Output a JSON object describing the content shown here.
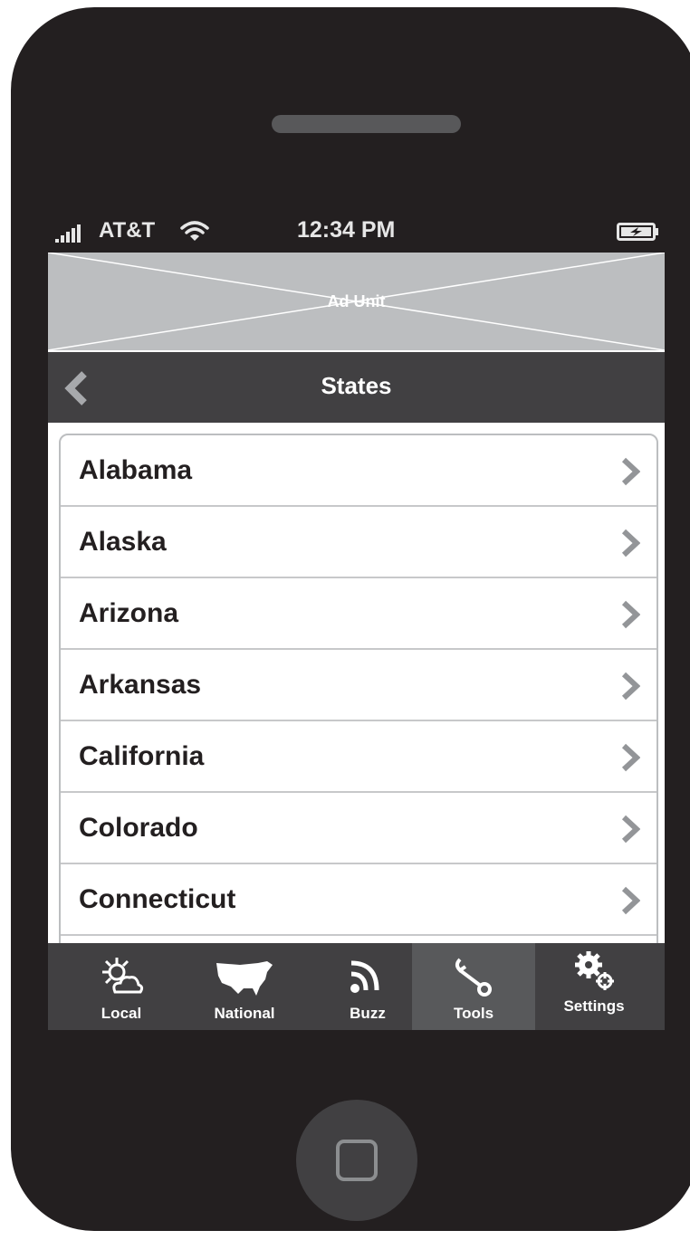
{
  "status_bar": {
    "carrier": "AT&T",
    "time": "12:34 PM"
  },
  "ad": {
    "label": "Ad Unit"
  },
  "nav": {
    "title": "States"
  },
  "states": [
    {
      "label": "Alabama"
    },
    {
      "label": "Alaska"
    },
    {
      "label": "Arizona"
    },
    {
      "label": "Arkansas"
    },
    {
      "label": "California"
    },
    {
      "label": "Colorado"
    },
    {
      "label": "Connecticut"
    },
    {
      "label": ""
    }
  ],
  "tabs": [
    {
      "label": "Local",
      "icon": "sun-cloud-icon"
    },
    {
      "label": "National",
      "icon": "usa-map-icon"
    },
    {
      "label": "Buzz",
      "icon": "rss-icon"
    },
    {
      "label": "Tools",
      "icon": "wrench-icon",
      "active": true
    },
    {
      "label": "Settings",
      "icon": "gears-icon"
    }
  ],
  "colors": {
    "phone_body": "#231f20",
    "nav_bar": "#414042",
    "tab_active": "#58595b",
    "ad_placeholder": "#bcbec0",
    "chevron": "#939598"
  }
}
